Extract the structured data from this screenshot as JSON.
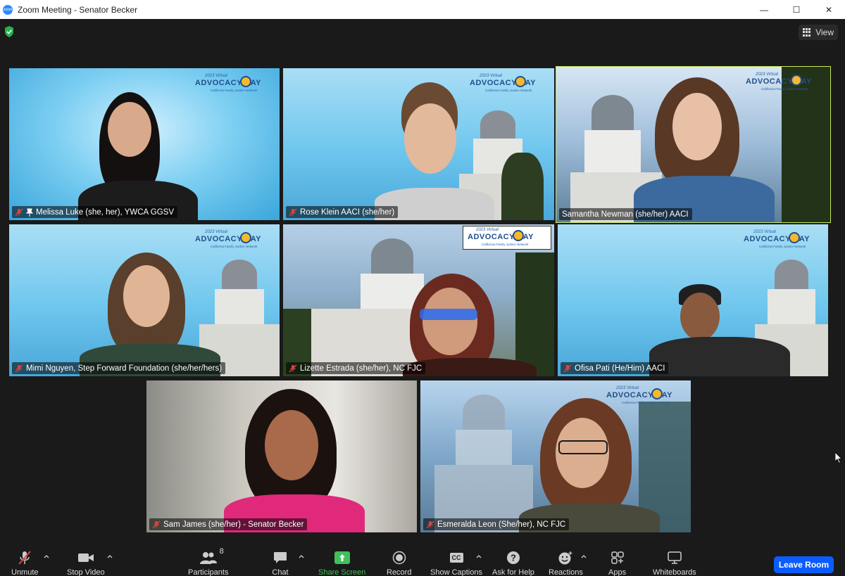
{
  "window": {
    "title": "Zoom Meeting - Senator Becker",
    "app_icon_text": "zoom"
  },
  "topbar": {
    "view_label": "View"
  },
  "logo": {
    "line1": "2023 Virtual",
    "line2": "ADVOCACY  DAY",
    "line3": "California Family Justice Network"
  },
  "participants": [
    {
      "name": "Melissa Luke (she, her), YWCA GGSV",
      "muted": true,
      "pinned": true,
      "active": false
    },
    {
      "name": "Rose Klein AACI (she/her)",
      "muted": true,
      "pinned": false,
      "active": false
    },
    {
      "name": "Samantha Newman (she/her) AACI",
      "muted": false,
      "pinned": false,
      "active": true
    },
    {
      "name": "Mimi Nguyen, Step Forward Foundation (she/her/hers)",
      "muted": true,
      "pinned": false,
      "active": false
    },
    {
      "name": "Lizette Estrada (she/her), NC FJC",
      "muted": true,
      "pinned": false,
      "active": false
    },
    {
      "name": "Ofisa Pati (He/Him) AACI",
      "muted": true,
      "pinned": false,
      "active": false
    },
    {
      "name": "Sam James (she/her) - Senator Becker",
      "muted": true,
      "pinned": false,
      "active": false
    },
    {
      "name": "Esmeralda Leon (She/her), NC FJC",
      "muted": true,
      "pinned": false,
      "active": false
    }
  ],
  "toolbar": {
    "unmute": "Unmute",
    "stop_video": "Stop Video",
    "participants": "Participants",
    "participants_count": "8",
    "chat": "Chat",
    "share_screen": "Share Screen",
    "record": "Record",
    "show_captions": "Show Captions",
    "captions_icon": "CC",
    "ask_for_help": "Ask for Help",
    "reactions": "Reactions",
    "apps": "Apps",
    "whiteboards": "Whiteboards",
    "leave_room": "Leave Room"
  },
  "colors": {
    "accent": "#0b5cff",
    "share_green": "#3fc15b",
    "active_speaker": "#c8e45a",
    "mute_red": "#e0433c"
  }
}
